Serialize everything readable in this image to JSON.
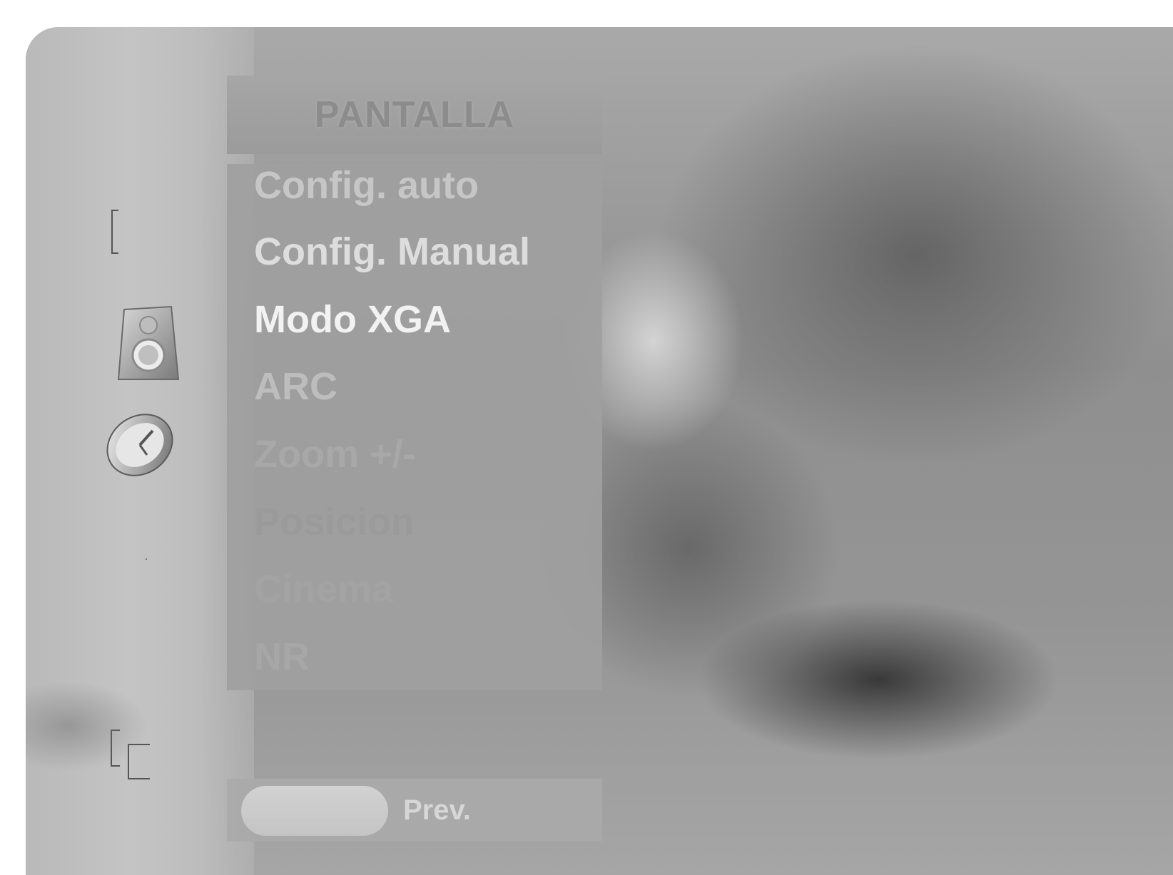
{
  "menu": {
    "title": "PANTALLA",
    "items": [
      {
        "label": "Config. auto"
      },
      {
        "label": "Config. Manual"
      },
      {
        "label": "Modo XGA"
      },
      {
        "label": "ARC"
      },
      {
        "label": "Zoom +/-"
      },
      {
        "label": "Posicion"
      },
      {
        "label": "Cinema"
      },
      {
        "label": "NR"
      }
    ]
  },
  "footer": {
    "prev_label": "Prev."
  },
  "side_icons": [
    "bracket-icon",
    "speaker-icon",
    "clock-icon",
    "corner-icon"
  ]
}
